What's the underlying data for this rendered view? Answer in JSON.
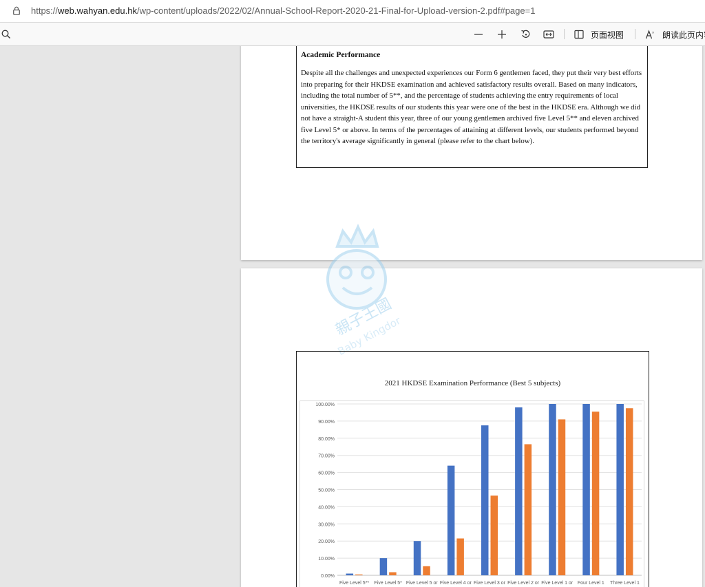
{
  "address_bar": {
    "url_prefix": "https://",
    "url_host": "web.wahyan.edu.hk",
    "url_path": "/wp-content/uploads/2022/02/Annual-School-Report-2020-21-Final-for-Upload-version-2.pdf#page=1"
  },
  "toolbar": {
    "page_view_label": "页面视图",
    "read_aloud_label": "朗读此页内容"
  },
  "document": {
    "section_heading": "Academic Performance",
    "paragraph": "Despite all the challenges and unexpected experiences our Form 6 gentlemen faced, they put their very best efforts into preparing for their HKDSE examination and achieved satisfactory results overall. Based on many indicators, including the total number of 5**, and the percentage of students achieving the entry requirements of local universities, the HKDSE results of our students this year were one of the best in the HKDSE era. Although we did not have a straight-A student this year, three of our young gentlemen archived five Level 5** and eleven archived five Level 5* or above. In terms of the percentages of attaining at different levels, our students performed beyond the territory's average significantly in general (please refer to the chart below).",
    "watermark_text": "Baby Kingdom",
    "watermark_cjk": "親子王國"
  },
  "chart_data": {
    "type": "bar",
    "title": "2021 HKDSE Examination Performance (Best 5 subjects)",
    "categories": [
      "Five Level 5**",
      "Five Level 5*",
      "Five Level 5 or",
      "Five Level 4 or",
      "Five Level 3 or",
      "Five Level 2 or",
      "Five Level 1 or",
      "Four Level 1",
      "Three Level 1"
    ],
    "y_ticks": [
      "0.00%",
      "10.00%",
      "20.00%",
      "30.00%",
      "40.00%",
      "50.00%",
      "60.00%",
      "70.00%",
      "80.00%",
      "90.00%",
      "100.00%"
    ],
    "ylim": [
      0,
      100
    ],
    "grid": true,
    "series": [
      {
        "color": "#4472c4",
        "values": [
          1.0,
          10.0,
          20.0,
          64.0,
          87.5,
          98.0,
          100.0,
          100.0,
          100.0
        ]
      },
      {
        "color": "#ed7d31",
        "values": [
          0.5,
          1.8,
          5.3,
          21.5,
          46.5,
          76.5,
          91.0,
          95.5,
          97.5
        ]
      }
    ]
  }
}
